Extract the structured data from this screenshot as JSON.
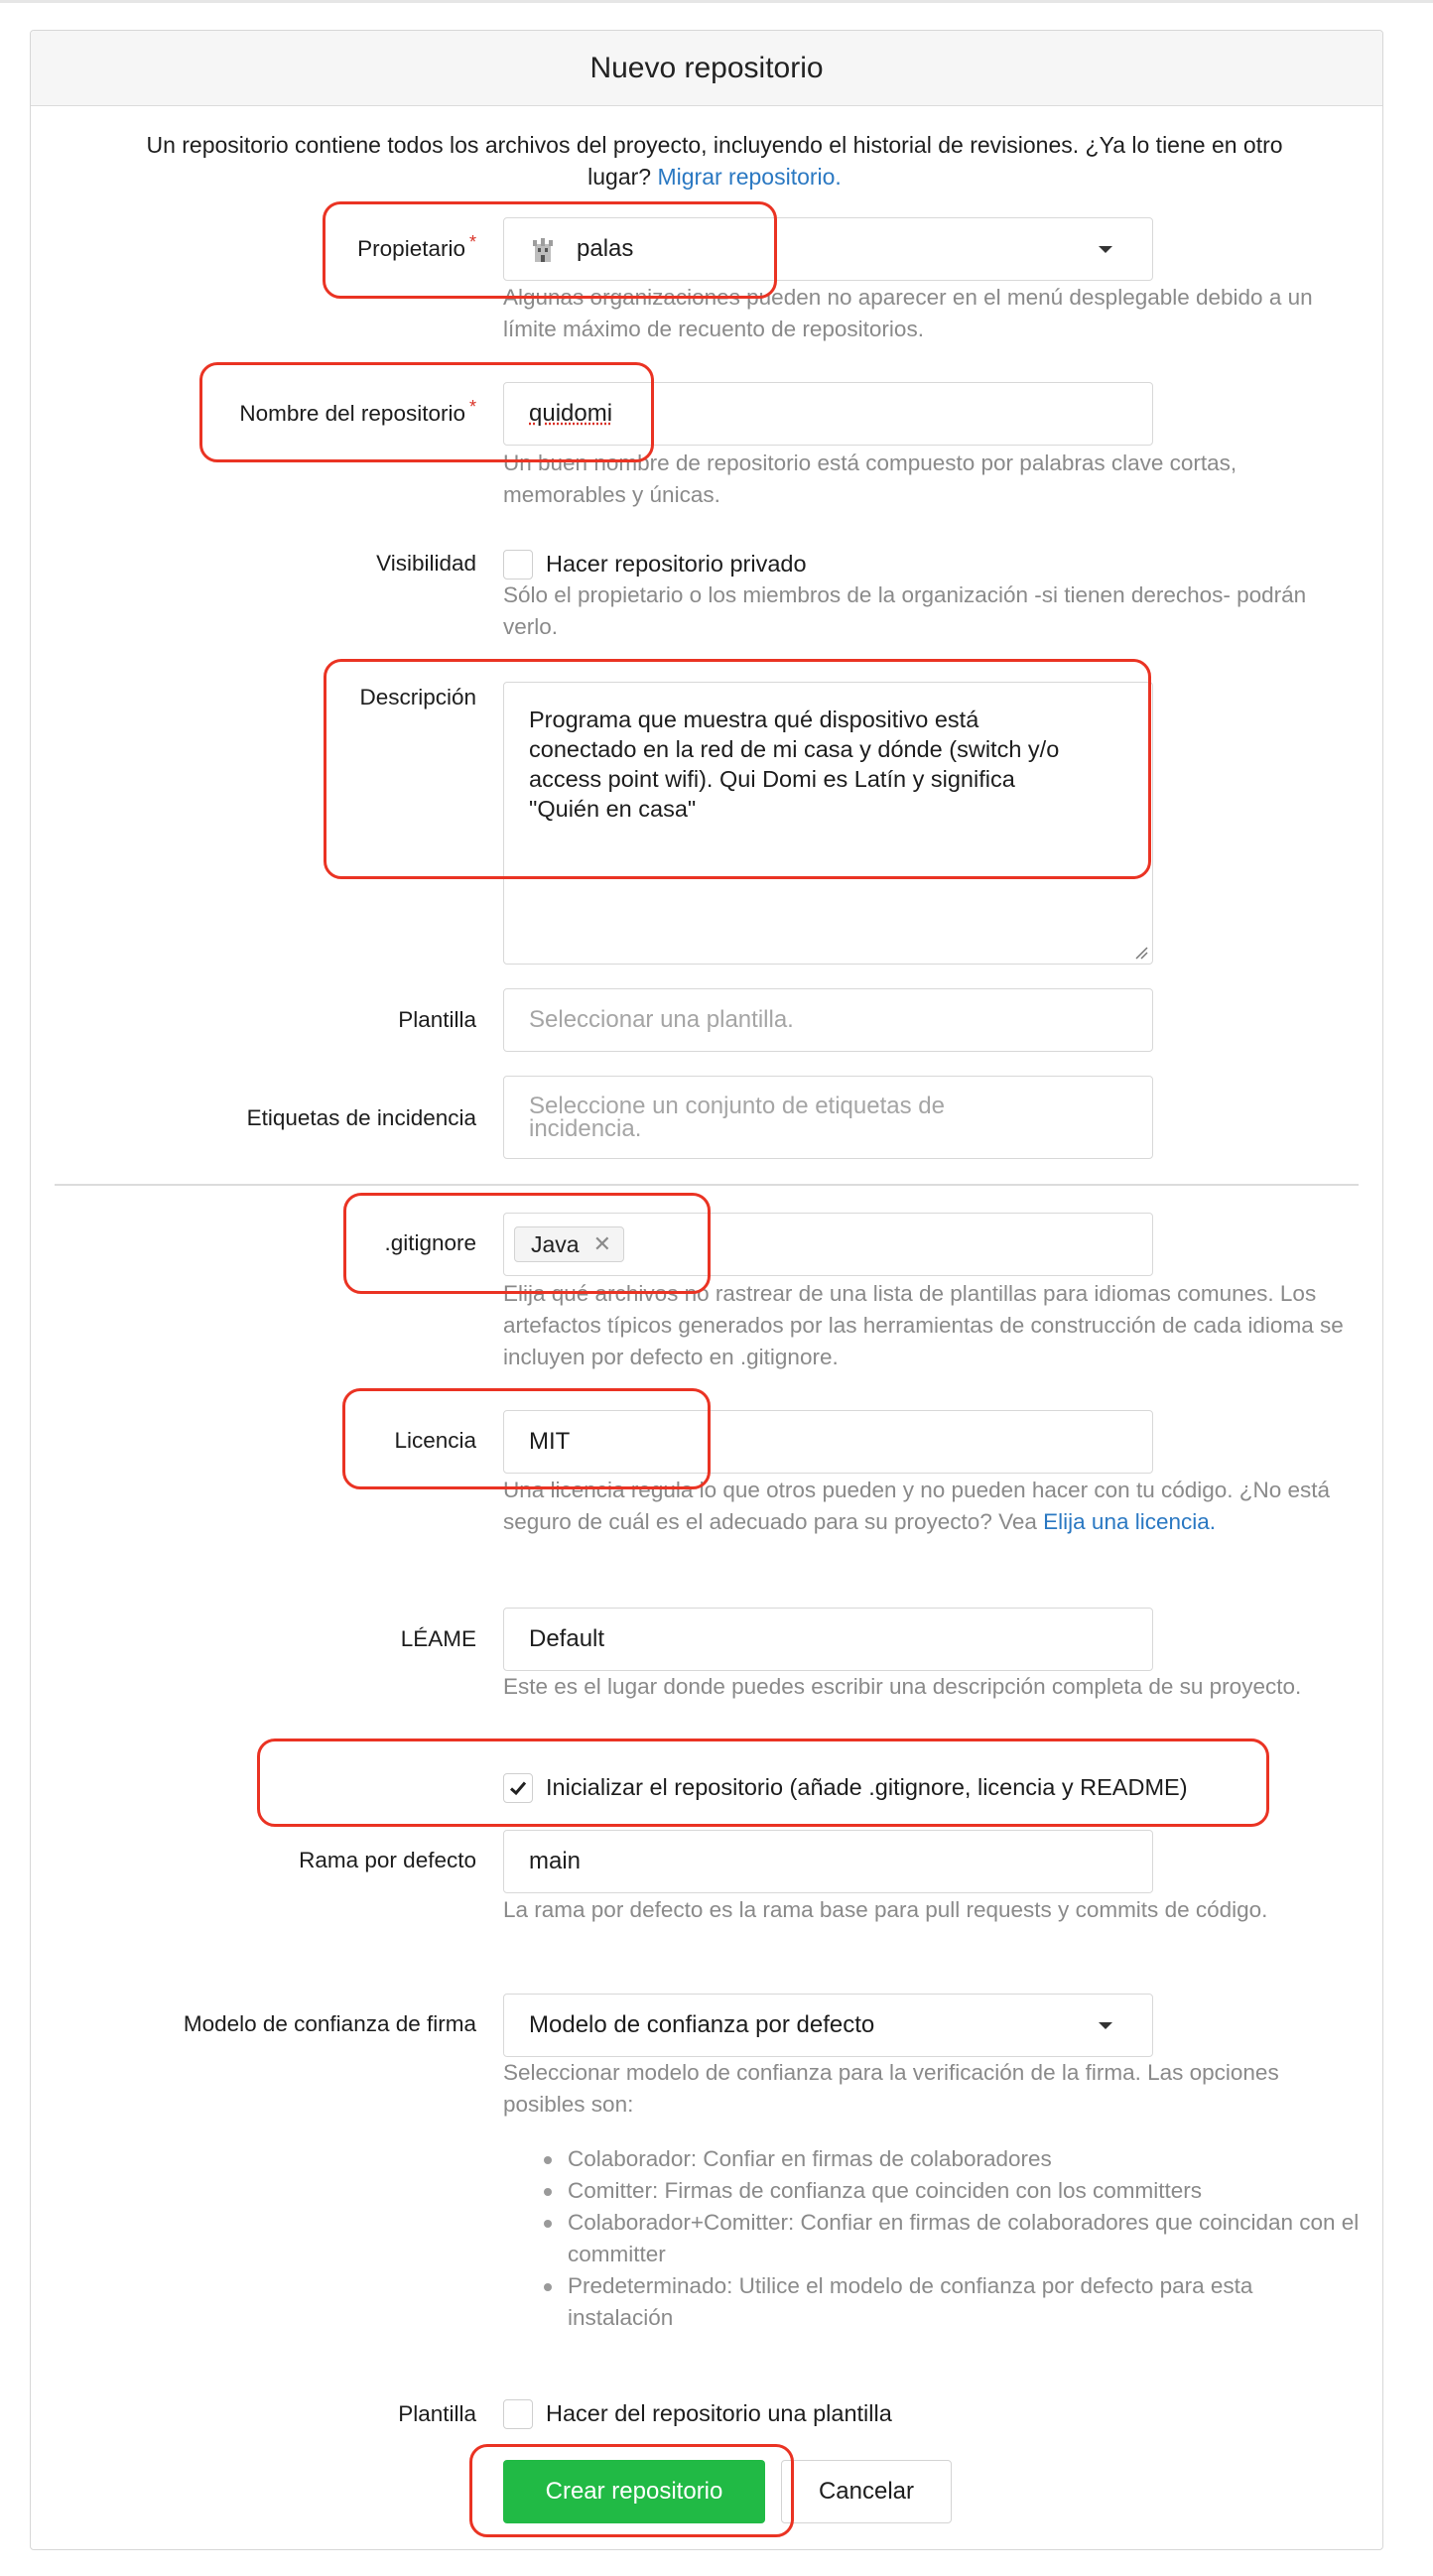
{
  "header": {
    "title": "Nuevo repositorio"
  },
  "intro": {
    "line1": "Un repositorio contiene todos los archivos del proyecto, incluyendo el historial de revisiones. ¿Ya lo tiene en otro",
    "line2_prefix": "lugar?",
    "migrate_link": "Migrar repositorio."
  },
  "owner": {
    "label": "Propietario",
    "required_mark": "*",
    "value": "palas",
    "help": "Algunas organizaciones pueden no aparecer en el menú desplegable debido a un límite máximo de recuento de repositorios."
  },
  "repo_name": {
    "label": "Nombre del repositorio",
    "required_mark": "*",
    "value": "quidomi",
    "help": "Un buen nombre de repositorio está compuesto por palabras clave cortas, memorables y únicas."
  },
  "visibility": {
    "label": "Visibilidad",
    "checkbox_label": "Hacer repositorio privado",
    "checked": false,
    "help": "Sólo el propietario o los miembros de la organización -si tienen derechos- podrán verlo."
  },
  "description": {
    "label": "Descripción",
    "value": "Programa que muestra qué dispositivo está conectado en la red de mi casa y dónde (switch y/o access point wifi). Qui Domi es Latín y significa \"Quién en casa\""
  },
  "template": {
    "label": "Plantilla",
    "placeholder": "Seleccionar una plantilla."
  },
  "issue_labels": {
    "label": "Etiquetas de incidencia",
    "placeholder": "Seleccione un conjunto de etiquetas de incidencia."
  },
  "gitignore": {
    "label": ".gitignore",
    "tag": "Java",
    "help": "Elija qué archivos no rastrear de una lista de plantillas para idiomas comunes. Los artefactos típicos generados por las herramientas de construcción de cada idioma se incluyen por defecto en .gitignore."
  },
  "license": {
    "label": "Licencia",
    "value": "MIT",
    "help_prefix": "Una licencia regula lo que otros pueden y no pueden hacer con tu código. ¿No está seguro de cuál es el adecuado para su proyecto? Vea",
    "help_link": "Elija una licencia."
  },
  "readme": {
    "label": "LÉAME",
    "value": "Default",
    "help": "Este es el lugar donde puedes escribir una descripción completa de su proyecto."
  },
  "auto_init": {
    "checkbox_label": "Inicializar el repositorio (añade .gitignore, licencia y README)",
    "checked": true
  },
  "default_branch": {
    "label": "Rama por defecto",
    "value": "main",
    "help": "La rama por defecto es la rama base para pull requests y commits de código."
  },
  "trust_model": {
    "label": "Modelo de confianza de firma",
    "value": "Modelo de confianza por defecto",
    "help": "Seleccionar modelo de confianza para la verificación de la firma. Las opciones posibles son:",
    "options": [
      "Colaborador: Confiar en firmas de colaboradores",
      "Comitter: Firmas de confianza que coinciden con los committers",
      "Colaborador+Comitter: Confiar en firmas de colaboradores que coincidan con el committer",
      "Predeterminado: Utilice el modelo de confianza por defecto para esta instalación"
    ]
  },
  "make_template": {
    "label": "Plantilla",
    "checkbox_label": "Hacer del repositorio una plantilla",
    "checked": false
  },
  "actions": {
    "create_label": "Crear repositorio",
    "cancel_label": "Cancelar"
  },
  "colors": {
    "primary_button": "#21ba45",
    "link": "#2a78c2",
    "annotation": "#ea3323",
    "required": "#d93025"
  }
}
